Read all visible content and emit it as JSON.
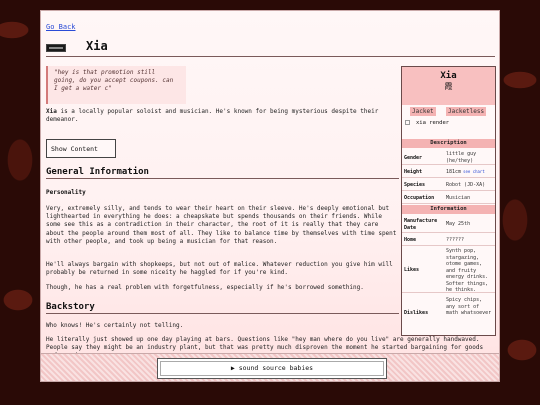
{
  "nav": {
    "back": "Go Back"
  },
  "page": {
    "title": "Xia"
  },
  "quote": "\"hey is that promotion still going, do you accept coupons. can I get a water c\"",
  "intro": {
    "name": "Xia",
    "text": " is a locally popular soloist and musician. He's known for being mysterious despite their demeanor."
  },
  "show_content_label": "Show Content",
  "sections": {
    "general": "General Information",
    "personality": "Personality",
    "backstory": "Backstory"
  },
  "paragraphs": {
    "p1": "Very, extremely silly, and tends to wear their heart on their sleeve. He's deeply emotional but lighthearted in everything he does: a cheapskate but spends thousands on their friends. While some see this as a contradiction in their character, the root of it is really that they care about the people around them most of all. They like to balance time by themselves with time spent with other people, and took up being a musician for that reason.",
    "p2": "He'll always bargain with shopkeeps, but not out of malice. Whatever reduction you give him will probably be returned in some niceity he haggled for if you're kind.",
    "p3": "Though, he has a real problem with forgetfulness, especially if he's borrowed something.",
    "p4": "Who knows! He's certainly not telling.",
    "p5": "He literally just showed up one day playing at bars. Questions like \"hey man where do you live\" are generally handwaved. People say they might be an industry plant, but that was pretty much disproven the moment he started bargaining for goods and services."
  },
  "infobox": {
    "name": "Xia",
    "kanji": "霞",
    "tabs": [
      "Jacket",
      "Jacketless"
    ],
    "image_alt": "xia render",
    "description_header": "Description",
    "information_header": "Information",
    "rows": {
      "gender": {
        "label": "Gender",
        "value": "little guy (he/they)"
      },
      "height": {
        "label": "Height",
        "value": "181cm",
        "link": "see chart"
      },
      "species": {
        "label": "Species",
        "value": "Robot (JD-XA)"
      },
      "occupation": {
        "label": "Occupation",
        "value": "Musician"
      },
      "manufacture": {
        "label": "Manufacture Date",
        "value": "May 25th"
      },
      "home": {
        "label": "Home",
        "value": "??????"
      },
      "likes": {
        "label": "Likes",
        "value": "Synth pop, stargazing, otome games, and fruity energy drinks. Softer things, he thinks."
      },
      "dislikes": {
        "label": "Dislikes",
        "value": "Spicy chips, any sort of math whatsoever"
      }
    }
  },
  "footer": {
    "player_label": "▶ sound source babies"
  }
}
